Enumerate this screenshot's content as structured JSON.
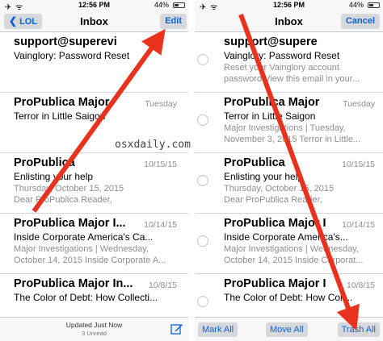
{
  "status_bar": {
    "time": "12:56 PM",
    "battery": "44%",
    "battery_level": 0.44
  },
  "left": {
    "back_label": "LOL",
    "title": "Inbox",
    "edit_label": "Edit",
    "messages": [
      {
        "sender": "support@superevi",
        "date": "",
        "subject": "Vainglory: Password Reset",
        "preview": ""
      },
      {
        "sender": "ProPublica Major",
        "date": "Tuesday",
        "subject": "Terror in Little Saigon",
        "preview": ""
      },
      {
        "sender": "ProPublica",
        "date": "10/15/15",
        "subject": "Enlisting your help",
        "preview": "Thursday, October 15, 2015\nDear ProPublica Reader,"
      },
      {
        "sender": "ProPublica Major I...",
        "date": "10/14/15",
        "subject": "Inside Corporate America's Ca...",
        "preview": "Major Investigations | Wednesday,\nOctober 14, 2015 Inside Corporate A..."
      },
      {
        "sender": "ProPublica Major In...",
        "date": "10/8/15",
        "subject": "The Color of Debt: How Collecti...",
        "preview": ""
      }
    ],
    "toolbar": {
      "updated": "Updated Just Now",
      "unread": "3 Unread"
    }
  },
  "right": {
    "title": "Inbox",
    "cancel_label": "Cancel",
    "messages": [
      {
        "sender": "support@supere",
        "date": "",
        "subject": "Vainglory: Password Reset",
        "preview": "Reset your Vainglory account\npassword View this email in your..."
      },
      {
        "sender": "ProPublica Major",
        "date": "Tuesday",
        "subject": "Terror in Little Saigon",
        "preview": "Major Investigations | Tuesday,\nNovember 3, 2015 Terror in Little..."
      },
      {
        "sender": "ProPublica",
        "date": "10/15/15",
        "subject": "Enlisting your help",
        "preview": "Thursday, October 15, 2015\nDear ProPublica Reader,"
      },
      {
        "sender": "ProPublica Major I",
        "date": "10/14/15",
        "subject": "Inside Corporate America's...",
        "preview": "Major Investigations | Wednesday,\nOctober 14, 2015 Inside Corporat..."
      },
      {
        "sender": "ProPublica Major I",
        "date": "10/8/15",
        "subject": "The Color of Debt: How Coll...",
        "preview": ""
      }
    ],
    "toolbar": {
      "mark_all": "Mark All",
      "move_all": "Move All",
      "trash_all": "Trash All"
    }
  },
  "watermark": "osxdaily.com",
  "colors": {
    "accent": "#0a63d6",
    "arrow": "#e8321e",
    "button_bg": "#d6d8dc"
  },
  "icons": {
    "back": "chevron-left-icon",
    "compose": "compose-icon",
    "select": "circle-outline-icon"
  }
}
